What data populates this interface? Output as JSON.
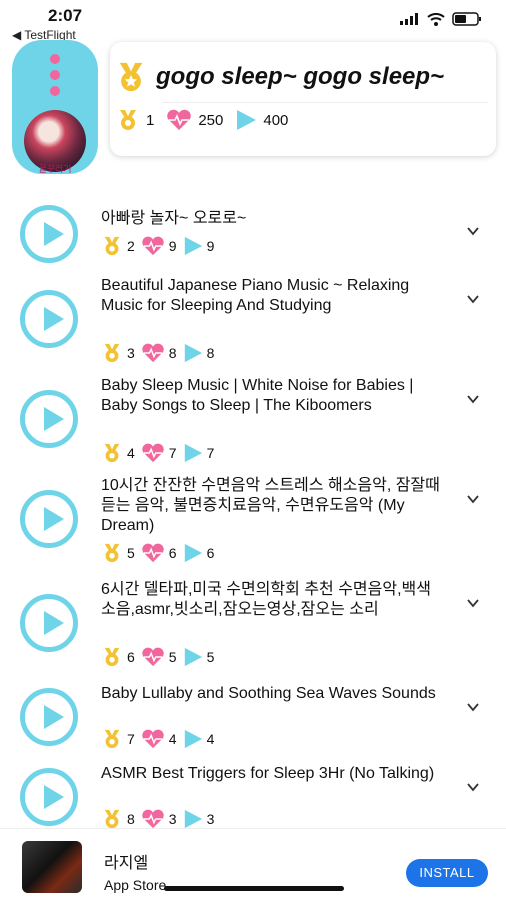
{
  "status": {
    "time": "2:07",
    "back_label": "◀ TestFlight"
  },
  "profile": {
    "caption": "꿀꾸러기"
  },
  "header": {
    "title": "gogo sleep~ gogo sleep~",
    "medals": "1",
    "likes": "250",
    "plays": "400"
  },
  "colors": {
    "accent": "#6fd4e8",
    "pink": "#f0679e",
    "gold": "#f2c232",
    "install": "#1d73e8"
  },
  "items": [
    {
      "title": "아빠랑 놀자~ 오로로~",
      "medals": "2",
      "likes": "9",
      "plays": "9"
    },
    {
      "title": "Beautiful Japanese Piano Music ~ Relaxing Music for Sleeping And Studying",
      "medals": "3",
      "likes": "8",
      "plays": "8"
    },
    {
      "title": "Baby Sleep Music | White Noise for Babies | Baby Songs to Sleep | The Kiboomers",
      "medals": "4",
      "likes": "7",
      "plays": "7"
    },
    {
      "title": "10시간 잔잔한 수면음악 스트레스 해소음악, 잠잘때 듣는 음악, 불면증치료음악, 수면유도음악 (My Dream)",
      "medals": "5",
      "likes": "6",
      "plays": "6"
    },
    {
      "title": "6시간 델타파,미국 수면의학회 추천 수면음악,백색소음,asmr,빗소리,잠오는영상,잠오는 소리",
      "medals": "6",
      "likes": "5",
      "plays": "5"
    },
    {
      "title": "Baby Lullaby and Soothing Sea Waves Sounds",
      "medals": "7",
      "likes": "4",
      "plays": "4"
    },
    {
      "title": "ASMR Best Triggers for Sleep 3Hr (No Talking)",
      "medals": "8",
      "likes": "3",
      "plays": "3"
    }
  ],
  "ad": {
    "app_name": "라지엘",
    "source": "App Store",
    "install_label": "INSTALL"
  }
}
